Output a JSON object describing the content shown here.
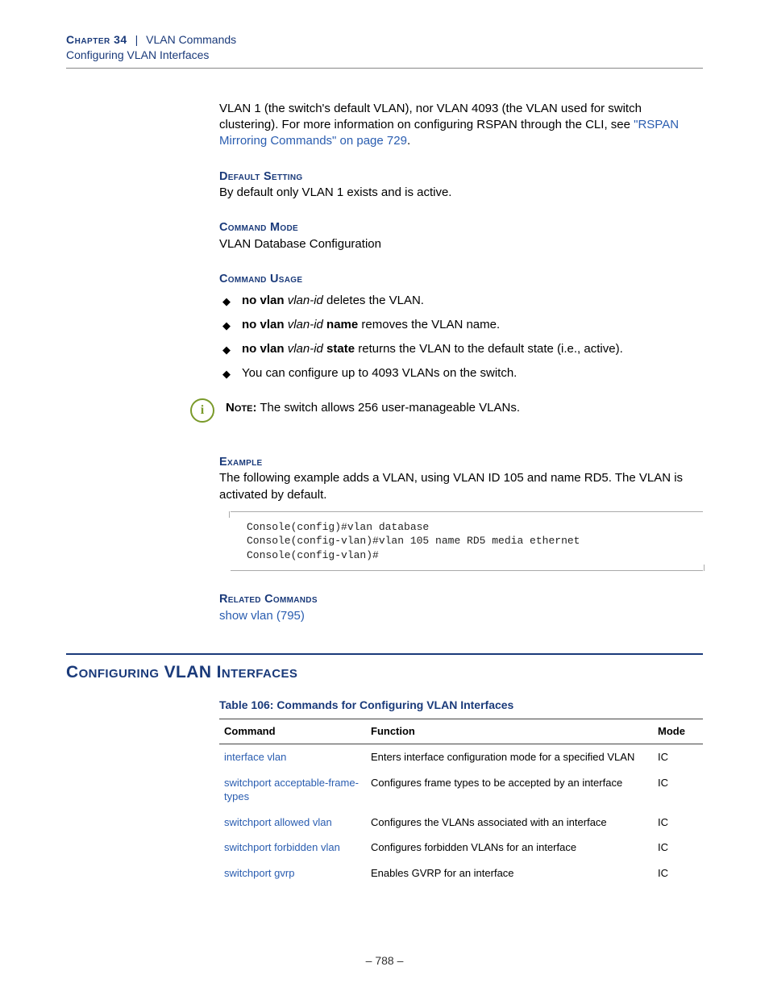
{
  "header": {
    "chapter_label": "Chapter 34",
    "pipe": "|",
    "chapter_title": "VLAN Commands",
    "subhead": "Configuring VLAN Interfaces"
  },
  "intro": {
    "text_before_link": "VLAN 1 (the switch's default VLAN), nor VLAN 4093 (the VLAN used for switch clustering). For more information on configuring RSPAN through the CLI, see ",
    "link_text": "\"RSPAN Mirroring Commands\" on page 729",
    "text_after_link": "."
  },
  "default_setting": {
    "heading": "Default Setting",
    "text": "By default only VLAN 1 exists and is active."
  },
  "command_mode": {
    "heading": "Command Mode",
    "text": "VLAN Database Configuration"
  },
  "command_usage": {
    "heading": "Command Usage",
    "items": [
      {
        "bold1": "no vlan",
        "ital": "vlan-id",
        "rest": " deletes the VLAN."
      },
      {
        "bold1": "no vlan",
        "ital": "vlan-id",
        "bold2": "name",
        "rest": " removes the VLAN name."
      },
      {
        "bold1": "no vlan",
        "ital": "vlan-id",
        "bold2": "state",
        "rest": " returns the VLAN to the default state (i.e., active)."
      },
      {
        "plain": "You can configure up to 4093 VLANs on the switch."
      }
    ]
  },
  "note": {
    "label": "Note:",
    "text": " The switch allows 256 user-manageable VLANs."
  },
  "example": {
    "heading": "Example",
    "text": "The following example adds a VLAN, using VLAN ID 105 and name RD5. The VLAN is activated by default.",
    "code": "Console(config)#vlan database\nConsole(config-vlan)#vlan 105 name RD5 media ethernet\nConsole(config-vlan)#"
  },
  "related": {
    "heading": "Related Commands",
    "link": "show vlan (795)"
  },
  "section": {
    "title": "Configuring VLAN Interfaces",
    "table_title": "Table 106: Commands for Configuring VLAN Interfaces",
    "columns": {
      "c1": "Command",
      "c2": "Function",
      "c3": "Mode"
    },
    "rows": [
      {
        "cmd": "interface vlan",
        "func": "Enters interface configuration mode for a specified VLAN",
        "mode": "IC"
      },
      {
        "cmd": "switchport acceptable-frame-types",
        "func": "Configures frame types to be accepted by an interface",
        "mode": "IC"
      },
      {
        "cmd": "switchport allowed vlan",
        "func": "Configures the VLANs associated with an interface",
        "mode": "IC"
      },
      {
        "cmd": "switchport forbidden vlan",
        "func": "Configures forbidden VLANs for an interface",
        "mode": "IC"
      },
      {
        "cmd": "switchport gvrp",
        "func": "Enables GVRP for an interface",
        "mode": "IC"
      }
    ]
  },
  "footer": {
    "page": "–  788  –"
  }
}
